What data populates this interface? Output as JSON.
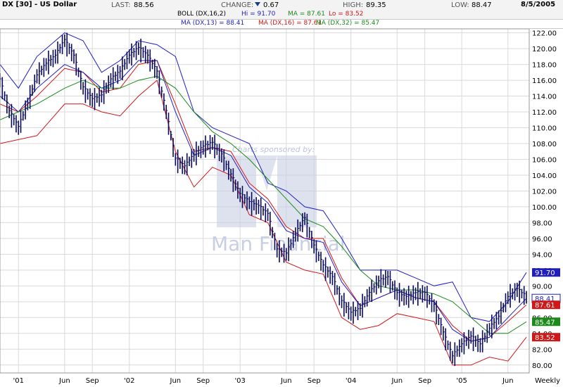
{
  "header": {
    "title": "DX [30] - US Dollar",
    "last_label": "LAST:",
    "last_value": "88.56",
    "change_label": "CHANGE:",
    "change_value": "0.67",
    "change_dir": "down",
    "high_label": "HIGH:",
    "high_value": "89.35",
    "low_label": "LOW:",
    "low_value": "88.47",
    "date": "8/5/2005",
    "boll_prefix": "BOLL (DX,16,2)",
    "boll_hi": "Hi = 91.70",
    "boll_ma": "MA = 87.61",
    "boll_lo": "Lo = 83.52",
    "ma1": "MA (DX,13) = 88.41",
    "ma2": "MA (DX,16) = 87.61",
    "ma3": "MA (DX,32) = 85.47"
  },
  "colors": {
    "price": "#0a0a5c",
    "boll_band": "#1f1fc0",
    "ma13": "#1f1fc0",
    "ma16": "#d01818",
    "ma32": "#1a8a1a",
    "boll_lo": "#d01818",
    "grid": "#d9d9d9",
    "watermark": "#c7cfe3"
  },
  "watermark_text_1": "Charts sponsored by:",
  "watermark_text_2": "Man Financial",
  "chart_data": {
    "type": "line",
    "title": "DX [30] - US Dollar",
    "frequency": "Weekly",
    "x_labels": [
      "'01",
      "Jun",
      "Sep",
      "'02",
      "Jun",
      "Sep",
      "'03",
      "Jun",
      "Sep",
      "'04",
      "Jun",
      "Sep",
      "'05",
      "Jun"
    ],
    "x_label_dates": [
      "2001-01",
      "2001-06",
      "2001-09",
      "2002-01",
      "2002-06",
      "2002-09",
      "2003-01",
      "2003-06",
      "2003-09",
      "2004-01",
      "2004-06",
      "2004-09",
      "2005-01",
      "2005-06"
    ],
    "x_range": [
      "2000-11",
      "2005-08"
    ],
    "ylim": [
      79,
      122.5
    ],
    "y_ticks": [
      80,
      82,
      84,
      86,
      88,
      90,
      92,
      94,
      96,
      98,
      100,
      102,
      104,
      106,
      108,
      110,
      112,
      114,
      116,
      118,
      120,
      122
    ],
    "y_tick_labels": [
      "80.00",
      "82.00",
      "84.00",
      "86.00",
      "88.00",
      "90.00",
      "92.00",
      "94.00",
      "96.00",
      "98.00",
      "100.00",
      "102.00",
      "104.00",
      "106.00",
      "108.00",
      "110.00",
      "112.00",
      "114.00",
      "116.00",
      "118.00",
      "120.00",
      "122.00"
    ],
    "grid": true,
    "series": [
      {
        "name": "DX",
        "style": "ohlc",
        "points": [
          [
            "2000-11",
            116
          ],
          [
            "2000-12",
            112
          ],
          [
            "2001-01",
            110
          ],
          [
            "2001-02",
            113
          ],
          [
            "2001-03",
            116.5
          ],
          [
            "2001-04",
            118
          ],
          [
            "2001-05",
            119
          ],
          [
            "2001-06",
            121
          ],
          [
            "2001-07",
            119
          ],
          [
            "2001-08",
            115
          ],
          [
            "2001-09",
            113.5
          ],
          [
            "2001-10",
            114
          ],
          [
            "2001-11",
            116
          ],
          [
            "2001-12",
            117
          ],
          [
            "2002-01",
            119
          ],
          [
            "2002-02",
            120
          ],
          [
            "2002-03",
            119
          ],
          [
            "2002-04",
            117
          ],
          [
            "2002-05",
            112
          ],
          [
            "2002-06",
            106
          ],
          [
            "2002-07",
            105
          ],
          [
            "2002-08",
            106.5
          ],
          [
            "2002-09",
            107.5
          ],
          [
            "2002-10",
            108
          ],
          [
            "2002-11",
            106.5
          ],
          [
            "2002-12",
            104
          ],
          [
            "2003-01",
            101.5
          ],
          [
            "2003-02",
            100.5
          ],
          [
            "2003-03",
            100
          ],
          [
            "2003-04",
            99
          ],
          [
            "2003-05",
            94.5
          ],
          [
            "2003-06",
            94
          ],
          [
            "2003-07",
            96.5
          ],
          [
            "2003-08",
            98.5
          ],
          [
            "2003-09",
            95
          ],
          [
            "2003-10",
            92.5
          ],
          [
            "2003-11",
            91
          ],
          [
            "2003-12",
            88
          ],
          [
            "2004-01",
            86.5
          ],
          [
            "2004-02",
            87
          ],
          [
            "2004-03",
            89
          ],
          [
            "2004-04",
            90.5
          ],
          [
            "2004-05",
            91
          ],
          [
            "2004-06",
            89
          ],
          [
            "2004-07",
            88.5
          ],
          [
            "2004-08",
            89
          ],
          [
            "2004-09",
            89
          ],
          [
            "2004-10",
            87.5
          ],
          [
            "2004-11",
            84
          ],
          [
            "2004-12",
            81
          ],
          [
            "2005-01",
            82.5
          ],
          [
            "2005-02",
            83.5
          ],
          [
            "2005-03",
            82.5
          ],
          [
            "2005-04",
            84.5
          ],
          [
            "2005-05",
            86
          ],
          [
            "2005-06",
            88.5
          ],
          [
            "2005-07",
            89.5
          ],
          [
            "2005-08",
            88.56
          ]
        ]
      },
      {
        "name": "BOLL (DX,16,2) Hi",
        "points": [
          [
            "2000-11",
            118
          ],
          [
            "2001-01",
            115
          ],
          [
            "2001-03",
            119
          ],
          [
            "2001-06",
            122
          ],
          [
            "2001-08",
            121
          ],
          [
            "2001-10",
            117
          ],
          [
            "2001-12",
            118.5
          ],
          [
            "2002-02",
            121
          ],
          [
            "2002-04",
            120.5
          ],
          [
            "2002-06",
            119
          ],
          [
            "2002-08",
            112
          ],
          [
            "2002-10",
            110
          ],
          [
            "2002-12",
            109
          ],
          [
            "2003-02",
            108
          ],
          [
            "2003-04",
            103
          ],
          [
            "2003-06",
            102
          ],
          [
            "2003-08",
            100
          ],
          [
            "2003-10",
            99.5
          ],
          [
            "2003-12",
            96
          ],
          [
            "2004-02",
            92
          ],
          [
            "2004-04",
            92
          ],
          [
            "2004-06",
            92
          ],
          [
            "2004-08",
            91
          ],
          [
            "2004-10",
            90
          ],
          [
            "2004-12",
            90.5
          ],
          [
            "2005-02",
            86
          ],
          [
            "2005-04",
            85.5
          ],
          [
            "2005-06",
            88
          ],
          [
            "2005-08",
            91.7
          ]
        ]
      },
      {
        "name": "MA (DX,16)",
        "points": [
          [
            "2000-11",
            113
          ],
          [
            "2001-01",
            112
          ],
          [
            "2001-03",
            114
          ],
          [
            "2001-06",
            117.5
          ],
          [
            "2001-08",
            117
          ],
          [
            "2001-10",
            114.5
          ],
          [
            "2001-12",
            115
          ],
          [
            "2002-02",
            118
          ],
          [
            "2002-04",
            118.5
          ],
          [
            "2002-06",
            113
          ],
          [
            "2002-08",
            107
          ],
          [
            "2002-10",
            107.5
          ],
          [
            "2002-12",
            107
          ],
          [
            "2003-02",
            103
          ],
          [
            "2003-04",
            101
          ],
          [
            "2003-06",
            97.5
          ],
          [
            "2003-08",
            96
          ],
          [
            "2003-10",
            96
          ],
          [
            "2003-12",
            91
          ],
          [
            "2004-02",
            87.5
          ],
          [
            "2004-04",
            88.5
          ],
          [
            "2004-06",
            89.5
          ],
          [
            "2004-08",
            88.5
          ],
          [
            "2004-10",
            88
          ],
          [
            "2004-12",
            85
          ],
          [
            "2005-02",
            83
          ],
          [
            "2005-04",
            83.5
          ],
          [
            "2005-06",
            85.5
          ],
          [
            "2005-08",
            87.61
          ]
        ]
      },
      {
        "name": "MA (DX,13)",
        "points": [
          [
            "2000-11",
            114
          ],
          [
            "2001-01",
            112
          ],
          [
            "2001-03",
            115
          ],
          [
            "2001-06",
            118
          ],
          [
            "2001-08",
            117
          ],
          [
            "2001-10",
            115
          ],
          [
            "2001-12",
            116
          ],
          [
            "2002-02",
            118.5
          ],
          [
            "2002-04",
            118.5
          ],
          [
            "2002-06",
            112
          ],
          [
            "2002-08",
            106.5
          ],
          [
            "2002-10",
            107.5
          ],
          [
            "2002-12",
            106.5
          ],
          [
            "2003-02",
            102.5
          ],
          [
            "2003-04",
            100.5
          ],
          [
            "2003-06",
            97
          ],
          [
            "2003-08",
            96
          ],
          [
            "2003-10",
            95.5
          ],
          [
            "2003-12",
            90.5
          ],
          [
            "2004-02",
            87.5
          ],
          [
            "2004-04",
            88.5
          ],
          [
            "2004-06",
            89.5
          ],
          [
            "2004-08",
            88.5
          ],
          [
            "2004-10",
            88
          ],
          [
            "2004-12",
            84.5
          ],
          [
            "2005-02",
            83
          ],
          [
            "2005-04",
            83.5
          ],
          [
            "2005-06",
            86
          ],
          [
            "2005-08",
            88.41
          ]
        ]
      },
      {
        "name": "MA (DX,32)",
        "points": [
          [
            "2000-11",
            111
          ],
          [
            "2001-01",
            112
          ],
          [
            "2001-03",
            113
          ],
          [
            "2001-06",
            115
          ],
          [
            "2001-08",
            116
          ],
          [
            "2001-10",
            115
          ],
          [
            "2001-12",
            115
          ],
          [
            "2002-02",
            116
          ],
          [
            "2002-04",
            116.5
          ],
          [
            "2002-06",
            115
          ],
          [
            "2002-08",
            112
          ],
          [
            "2002-10",
            109.5
          ],
          [
            "2002-12",
            108
          ],
          [
            "2003-02",
            106
          ],
          [
            "2003-04",
            103.5
          ],
          [
            "2003-06",
            101
          ],
          [
            "2003-08",
            98.5
          ],
          [
            "2003-10",
            97.5
          ],
          [
            "2003-12",
            95
          ],
          [
            "2004-02",
            92
          ],
          [
            "2004-04",
            90
          ],
          [
            "2004-06",
            89.5
          ],
          [
            "2004-08",
            89.5
          ],
          [
            "2004-10",
            89
          ],
          [
            "2004-12",
            88
          ],
          [
            "2005-02",
            86
          ],
          [
            "2005-04",
            84
          ],
          [
            "2005-06",
            84
          ],
          [
            "2005-08",
            85.47
          ]
        ]
      },
      {
        "name": "BOLL (DX,16,2) Lo",
        "points": [
          [
            "2000-11",
            108
          ],
          [
            "2001-01",
            108.5
          ],
          [
            "2001-03",
            109
          ],
          [
            "2001-06",
            113
          ],
          [
            "2001-08",
            113
          ],
          [
            "2001-10",
            112
          ],
          [
            "2001-12",
            111.5
          ],
          [
            "2002-02",
            114
          ],
          [
            "2002-04",
            116
          ],
          [
            "2002-06",
            107
          ],
          [
            "2002-08",
            102.5
          ],
          [
            "2002-10",
            105
          ],
          [
            "2002-12",
            104
          ],
          [
            "2003-02",
            99
          ],
          [
            "2003-04",
            98
          ],
          [
            "2003-06",
            93
          ],
          [
            "2003-08",
            92
          ],
          [
            "2003-10",
            91.5
          ],
          [
            "2003-12",
            86
          ],
          [
            "2004-02",
            84.5
          ],
          [
            "2004-04",
            85
          ],
          [
            "2004-06",
            86.5
          ],
          [
            "2004-08",
            86
          ],
          [
            "2004-10",
            85.5
          ],
          [
            "2004-12",
            80
          ],
          [
            "2005-02",
            80
          ],
          [
            "2005-04",
            81
          ],
          [
            "2005-06",
            80.5
          ],
          [
            "2005-08",
            83.52
          ]
        ]
      }
    ],
    "last_value_labels": [
      {
        "series": "BOLL (DX,16,2) Hi",
        "text": "91.70",
        "value": 91.7
      },
      {
        "series": "MA (DX,13)",
        "text": "88.41",
        "value": 88.41
      },
      {
        "series": "MA (DX,16)",
        "text": "87.61",
        "value": 87.61
      },
      {
        "series": "MA (DX,32)",
        "text": "85.47",
        "value": 85.47
      },
      {
        "series": "BOLL (DX,16,2) Lo",
        "text": "83.52",
        "value": 83.52
      }
    ]
  }
}
